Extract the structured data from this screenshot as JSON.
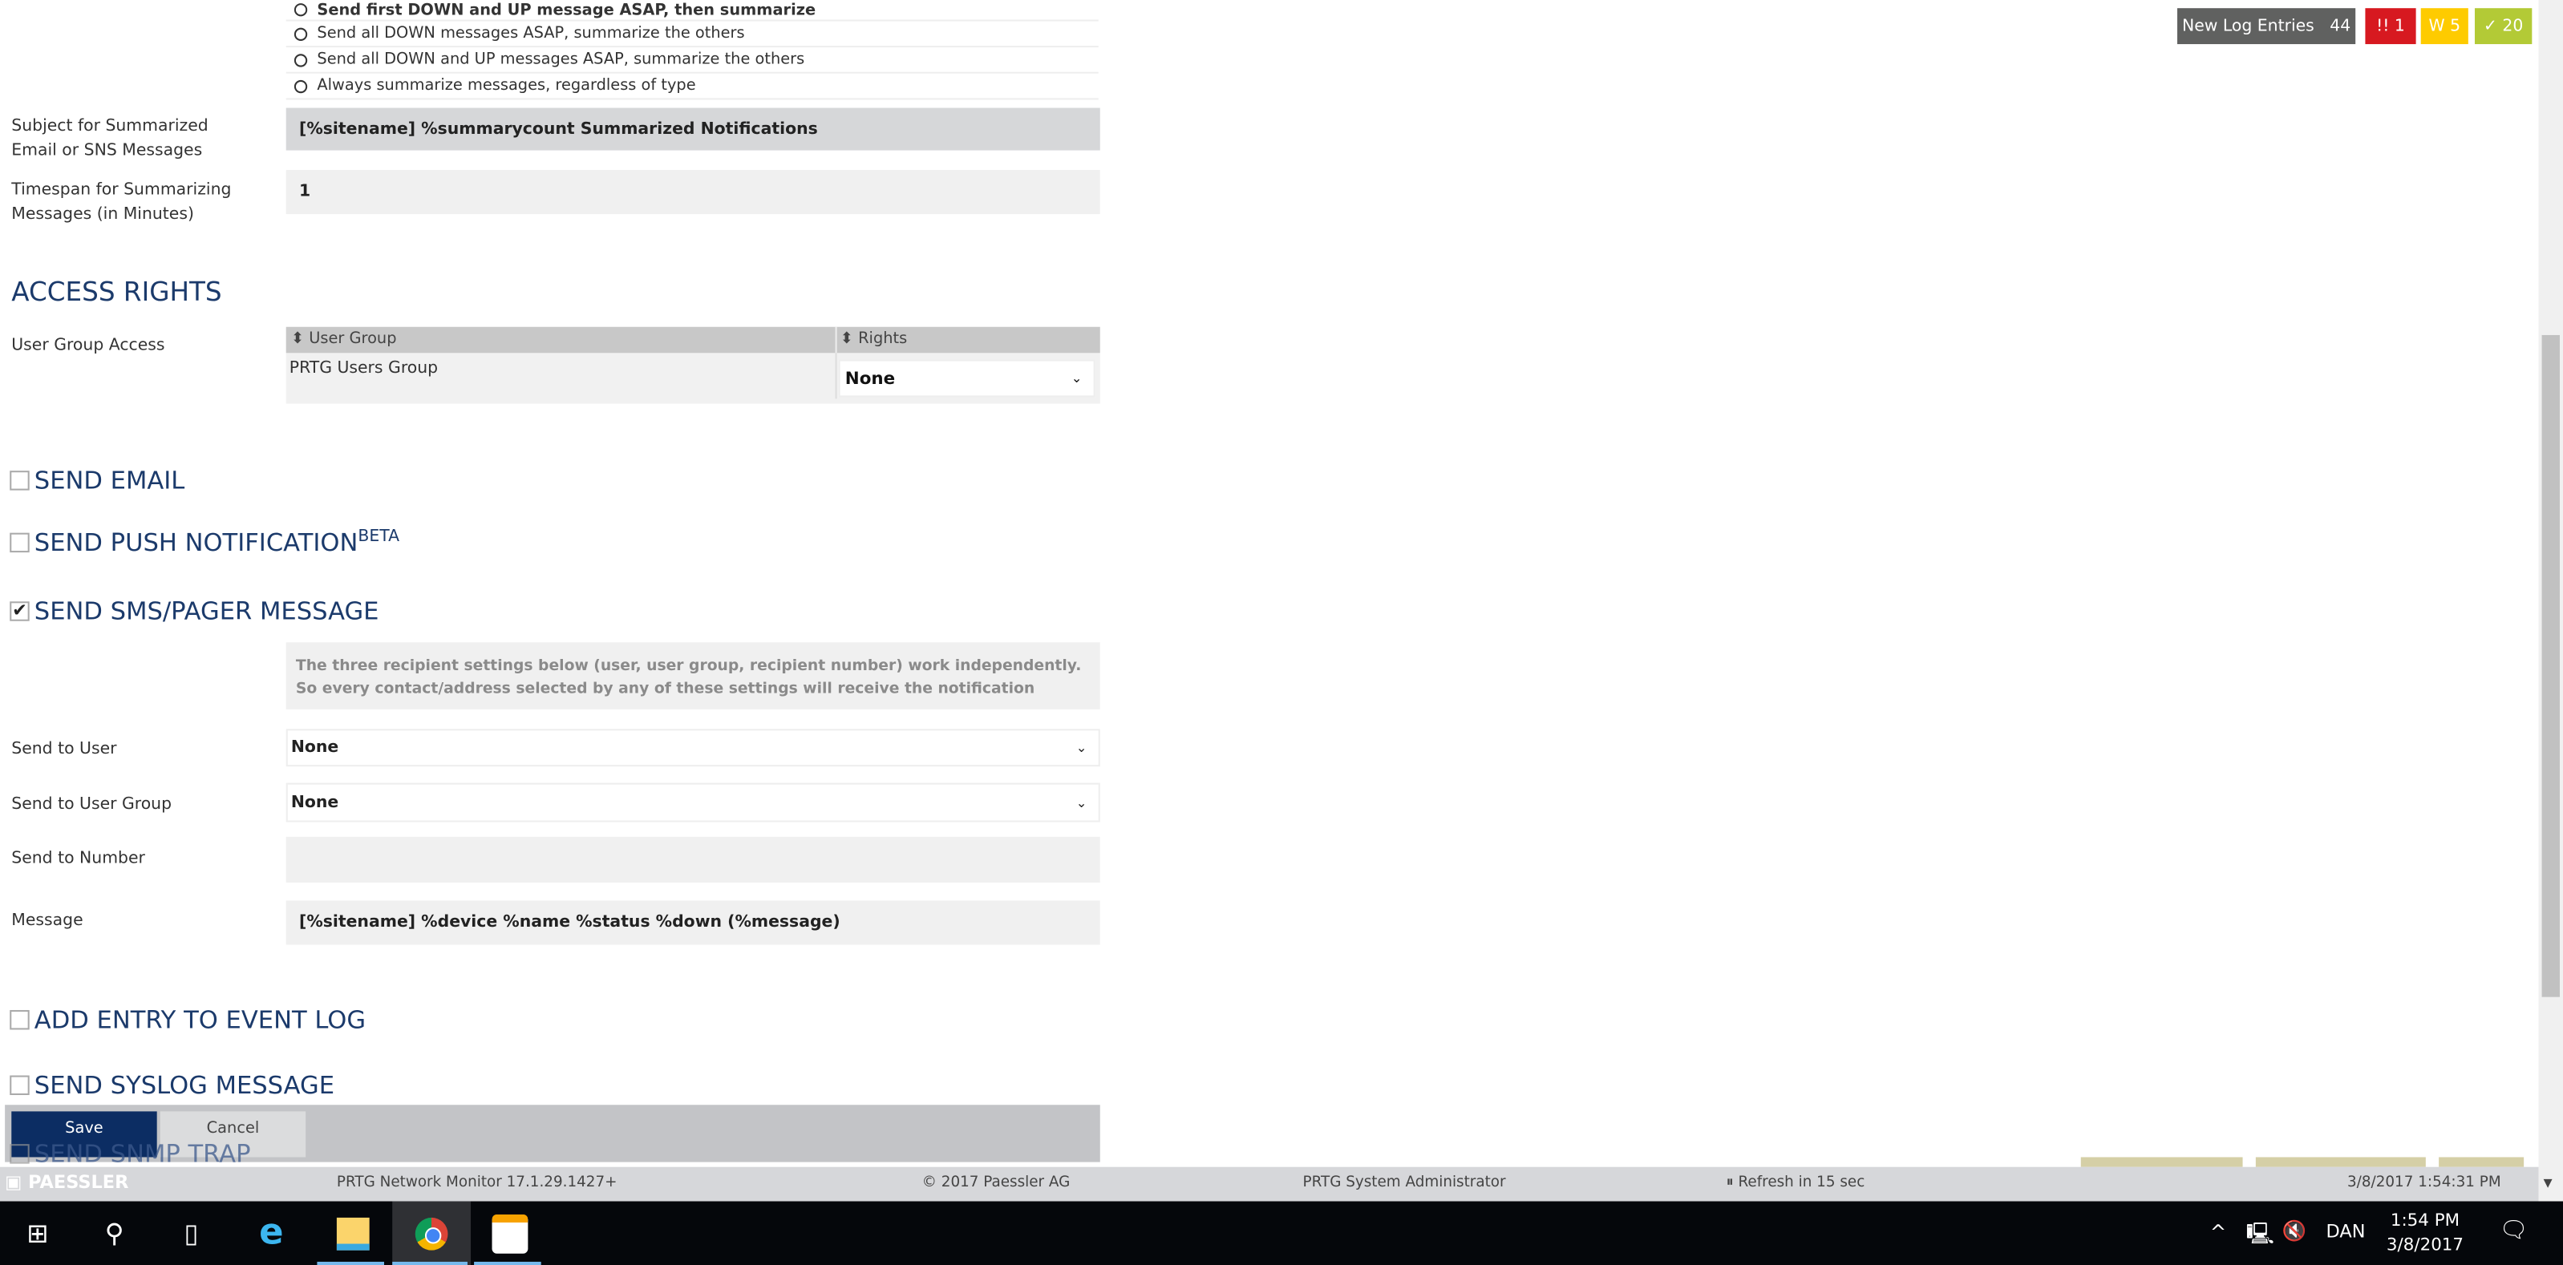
{
  "summarize": {
    "options": [
      "Send first DOWN and UP message ASAP, then summarize",
      "Send all DOWN messages ASAP, summarize the others",
      "Send all DOWN and UP messages ASAP, summarize the others",
      "Always summarize messages, regardless of type"
    ],
    "subject_label": "Subject for Summarized Email or SNS Messages",
    "subject_value": "[%sitename] %summarycount Summarized Notifications",
    "timespan_label": "Timespan for Summarizing Messages (in Minutes)",
    "timespan_value": "1"
  },
  "access": {
    "heading": "ACCESS RIGHTS",
    "label": "User Group Access",
    "col_group": "User Group",
    "col_rights": "Rights",
    "rows": [
      {
        "group": "PRTG Users Group",
        "rights": "None"
      }
    ]
  },
  "sections": {
    "email": {
      "label": "SEND EMAIL",
      "checked": false
    },
    "push": {
      "label": "SEND PUSH NOTIFICATION",
      "sup": "BETA",
      "checked": false
    },
    "sms": {
      "label": "SEND SMS/PAGER MESSAGE",
      "checked": true
    },
    "eventlog": {
      "label": "ADD ENTRY TO EVENT LOG",
      "checked": false
    },
    "syslog": {
      "label": "SEND SYSLOG MESSAGE",
      "checked": false
    },
    "snmp": {
      "label": "SEND SNMP TRAP",
      "checked": false
    }
  },
  "sms": {
    "info": "The three recipient settings below (user, user group, recipient number) work independently. So every contact/address selected by any of these settings will receive the notification",
    "user_label": "Send to User",
    "user_value": "None",
    "group_label": "Send to User Group",
    "group_value": "None",
    "number_label": "Send to Number",
    "number_value": "",
    "message_label": "Message",
    "message_value": "[%sitename] %device %name %status %down (%message)"
  },
  "actions": {
    "save": "Save",
    "cancel": "Cancel"
  },
  "badges": {
    "log_label": "New Log Entries",
    "log_count": "44",
    "alarm": "!! 1",
    "warning": "W 5",
    "ok": "✓ 20",
    "colors": {
      "log": "#606160",
      "alarm": "#d71920",
      "warning": "#fecb00",
      "ok": "#b3ca36"
    }
  },
  "footer": {
    "logo": "PAESSLER",
    "version": "PRTG Network Monitor 17.1.29.1427+",
    "copyright": "© 2017 Paessler AG",
    "user": "PRTG System Administrator",
    "refresh": "Refresh in 15 sec",
    "datetime": "3/8/2017 1:54:31 PM"
  },
  "taskbar": {
    "lang": "DAN",
    "time": "1:54 PM",
    "date": "3/8/2017"
  }
}
